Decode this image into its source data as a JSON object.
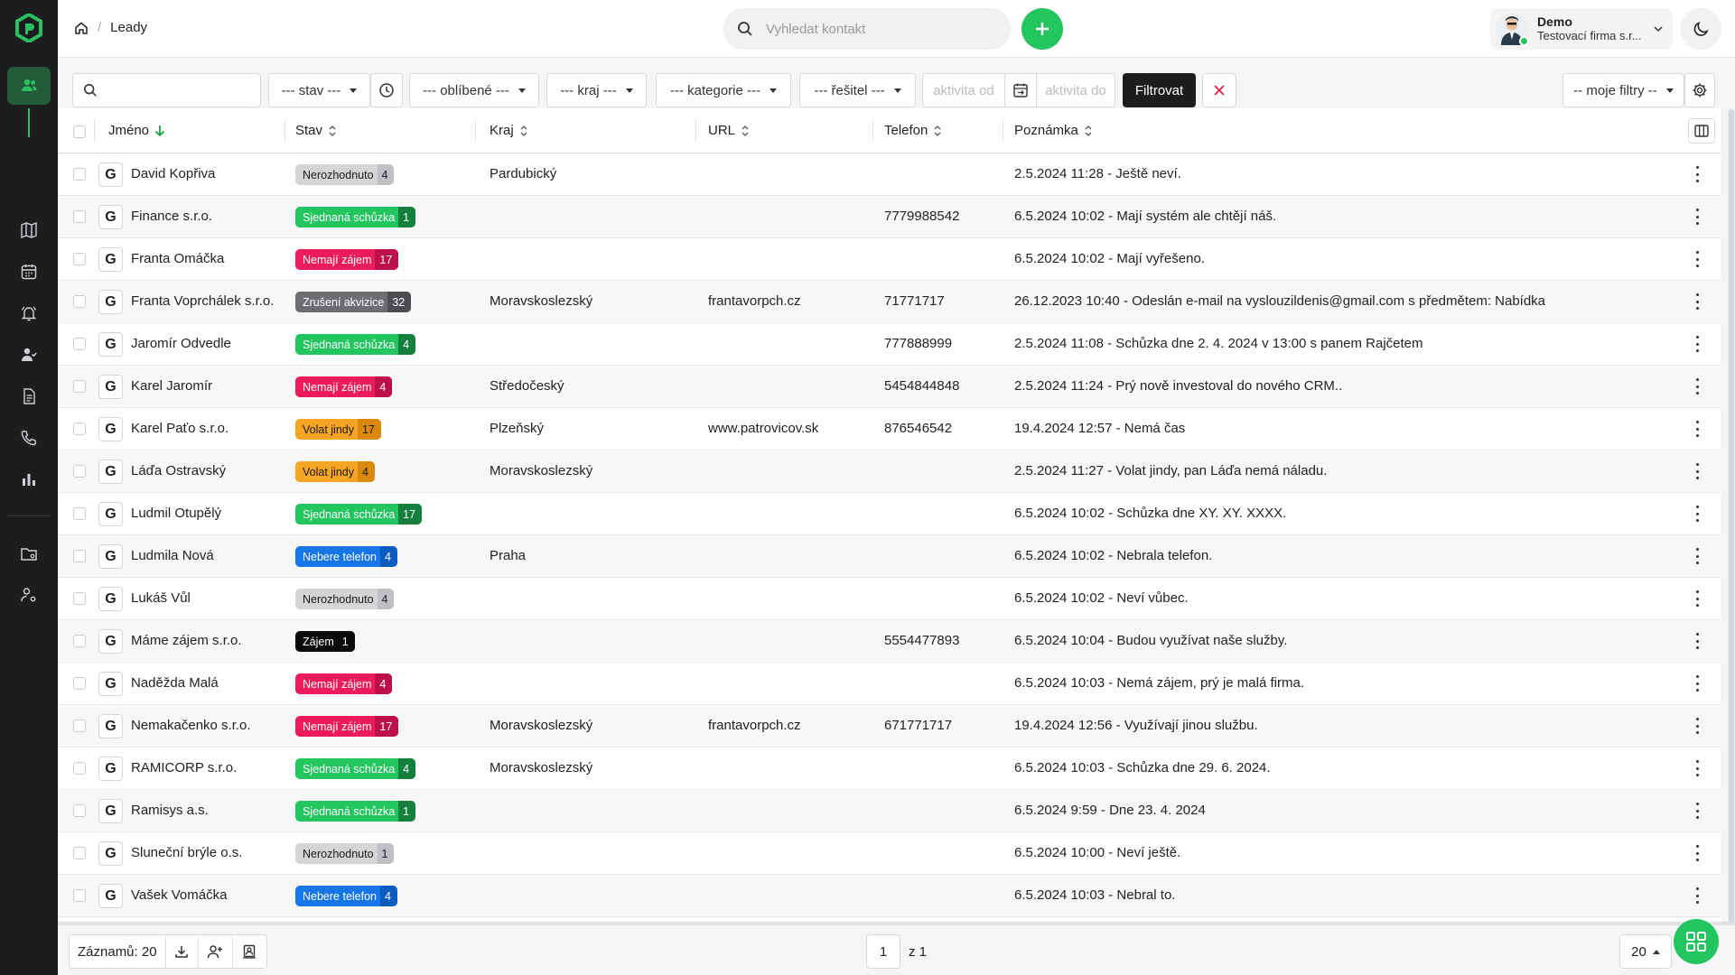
{
  "breadcrumb": {
    "current": "Leady"
  },
  "search": {
    "placeholder": "Vyhledat kontakt"
  },
  "user": {
    "name": "Demo",
    "company": "Testovací firma s.r..."
  },
  "filters": {
    "search_value": "",
    "stav": "--- stav ---",
    "oblibene": "--- oblíbené ---",
    "kraj": "--- kraj ---",
    "kategorie": "--- kategorie ---",
    "resitel": "--- řešitel ---",
    "aktivita_od": "aktivita od",
    "aktivita_do": "aktivita do",
    "filter_button": "Filtrovat",
    "moje_filtry": "-- moje filtry --"
  },
  "columns": {
    "jmeno": "Jméno",
    "stav": "Stav",
    "kraj": "Kraj",
    "url": "URL",
    "telefon": "Telefon",
    "poznamka": "Poznámka"
  },
  "status_colors": {
    "Nerozhodnuto": "#d4d5d7",
    "Sjednaná schůzka": "#22c55e",
    "Nemají zájem": "#ec1c5c",
    "Zrušení akvizice": "#6b6d70",
    "Volat jindy": "#f5a524",
    "Nebere telefon": "#1676e8",
    "Zájem": "#0b0b0b"
  },
  "rows": [
    {
      "source": "G",
      "name": "David Kopřiva",
      "status": "Nerozhodnuto",
      "count": "4",
      "kraj": "Pardubický",
      "url": "",
      "telefon": "",
      "poznamka": "2.5.2024 11:28 - Ještě neví."
    },
    {
      "source": "G",
      "name": "Finance s.r.o.",
      "status": "Sjednaná schůzka",
      "count": "1",
      "kraj": "",
      "url": "",
      "telefon": "7779988542",
      "poznamka": "6.5.2024 10:02 - Mají systém ale chtějí náš."
    },
    {
      "source": "G",
      "name": "Franta Omáčka",
      "status": "Nemají zájem",
      "count": "17",
      "kraj": "",
      "url": "",
      "telefon": "",
      "poznamka": "6.5.2024 10:02 - Mají vyřešeno."
    },
    {
      "source": "G",
      "name": "Franta Voprchálek s.r.o.",
      "status": "Zrušení akvizice",
      "count": "32",
      "kraj": "Moravskoslezský",
      "url": "frantavorpch.cz",
      "telefon": "71771717",
      "poznamka": "26.12.2023 10:40 - Odeslán e-mail na vyslouzildenis@gmail.com s předmětem: Nabídka"
    },
    {
      "source": "G",
      "name": "Jaromír Odvedle",
      "status": "Sjednaná schůzka",
      "count": "4",
      "kraj": "",
      "url": "",
      "telefon": "777888999",
      "poznamka": "2.5.2024 11:08 - Schůzka dne 2. 4. 2024 v 13:00 s panem Rajčetem"
    },
    {
      "source": "G",
      "name": "Karel Jaromír",
      "status": "Nemají zájem",
      "count": "4",
      "kraj": "Středočeský",
      "url": "",
      "telefon": "5454844848",
      "poznamka": "2.5.2024 11:24 - Prý nově investoval do nového CRM.."
    },
    {
      "source": "G",
      "name": "Karel Paťo s.r.o.",
      "status": "Volat jindy",
      "count": "17",
      "kraj": "Plzeňský",
      "url": "www.patrovicov.sk",
      "telefon": "876546542",
      "poznamka": "19.4.2024 12:57 - Nemá čas"
    },
    {
      "source": "G",
      "name": "Láďa Ostravský",
      "status": "Volat jindy",
      "count": "4",
      "kraj": "Moravskoslezský",
      "url": "",
      "telefon": "",
      "poznamka": "2.5.2024 11:27 - Volat jindy, pan Láďa nemá náladu."
    },
    {
      "source": "G",
      "name": "Ludmil Otupělý",
      "status": "Sjednaná schůzka",
      "count": "17",
      "kraj": "",
      "url": "",
      "telefon": "",
      "poznamka": "6.5.2024 10:02 - Schůzka dne XY. XY. XXXX."
    },
    {
      "source": "G",
      "name": "Ludmila Nová",
      "status": "Nebere telefon",
      "count": "4",
      "kraj": "Praha",
      "url": "",
      "telefon": "",
      "poznamka": "6.5.2024 10:02 - Nebrala telefon."
    },
    {
      "source": "G",
      "name": "Lukáš Vůl",
      "status": "Nerozhodnuto",
      "count": "4",
      "kraj": "",
      "url": "",
      "telefon": "",
      "poznamka": "6.5.2024 10:02 - Neví vůbec."
    },
    {
      "source": "G",
      "name": "Máme zájem s.r.o.",
      "status": "Zájem",
      "count": "1",
      "kraj": "",
      "url": "",
      "telefon": "5554477893",
      "poznamka": "6.5.2024 10:04 - Budou využívat naše služby."
    },
    {
      "source": "G",
      "name": "Naděžda Malá",
      "status": "Nemají zájem",
      "count": "4",
      "kraj": "",
      "url": "",
      "telefon": "",
      "poznamka": "6.5.2024 10:03 - Nemá zájem, prý je malá firma."
    },
    {
      "source": "G",
      "name": "Nemakačenko s.r.o.",
      "status": "Nemají zájem",
      "count": "17",
      "kraj": "Moravskoslezský",
      "url": "frantavorpch.cz",
      "telefon": "671771717",
      "poznamka": "19.4.2024 12:56 - Využívají jinou službu."
    },
    {
      "source": "G",
      "name": "RAMICORP s.r.o.",
      "status": "Sjednaná schůzka",
      "count": "4",
      "kraj": "Moravskoslezský",
      "url": "",
      "telefon": "",
      "poznamka": "6.5.2024 10:03 - Schůzka dne 29. 6. 2024."
    },
    {
      "source": "G",
      "name": "Ramisys a.s.",
      "status": "Sjednaná schůzka",
      "count": "1",
      "kraj": "",
      "url": "",
      "telefon": "",
      "poznamka": "6.5.2024 9:59 - Dne 23. 4. 2024"
    },
    {
      "source": "G",
      "name": "Sluneční brýle o.s.",
      "status": "Nerozhodnuto",
      "count": "1",
      "kraj": "",
      "url": "",
      "telefon": "",
      "poznamka": "6.5.2024 10:00 - Neví ještě."
    },
    {
      "source": "G",
      "name": "Vašek Vomáčka",
      "status": "Nebere telefon",
      "count": "4",
      "kraj": "",
      "url": "",
      "telefon": "",
      "poznamka": "6.5.2024 10:03 - Nebral to."
    }
  ],
  "footer": {
    "records_label": "Záznamů: 20",
    "page": "1",
    "page_of": "z 1",
    "page_size": "20"
  }
}
